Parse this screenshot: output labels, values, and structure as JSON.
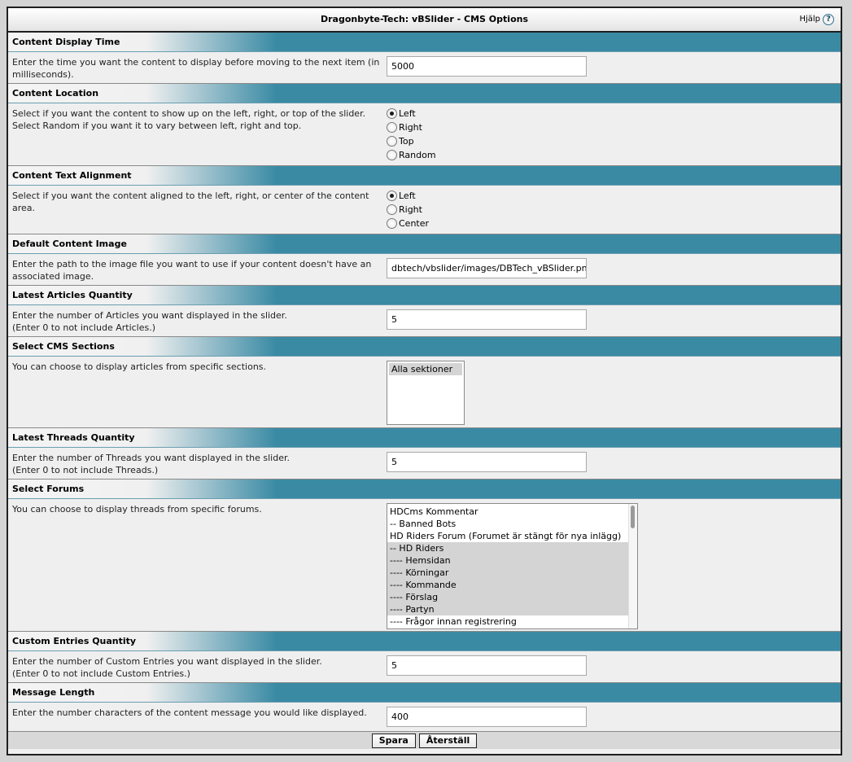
{
  "window": {
    "title": "Dragonbyte-Tech: vBSlider - CMS Options",
    "help_label": "Hjälp",
    "help_icon": "question-icon"
  },
  "sections": {
    "display_time": {
      "title": "Content Display Time",
      "desc": "Enter the time you want the content to display before moving to the next item (in milliseconds).",
      "value": "5000"
    },
    "location": {
      "title": "Content Location",
      "desc_1": "Select if you want the content to show up on the left, right, or top of the slider.",
      "desc_2": "Select Random if you want it to vary between left, right and top.",
      "options": [
        "Left",
        "Right",
        "Top",
        "Random"
      ],
      "selected": "Left"
    },
    "alignment": {
      "title": "Content Text Alignment",
      "desc": "Select if you want the content aligned to the left, right, or center of the content area.",
      "options": [
        "Left",
        "Right",
        "Center"
      ],
      "selected": "Left"
    },
    "default_image": {
      "title": "Default Content Image",
      "desc": "Enter the path to the image file you want to use if your content doesn't have an associated image.",
      "value": "dbtech/vbslider/images/DBTech_vBSlider.png"
    },
    "articles_qty": {
      "title": "Latest Articles Quantity",
      "desc_1": "Enter the number of Articles you want displayed in the slider.",
      "desc_2": "(Enter 0 to not include Articles.)",
      "value": "5"
    },
    "cms_sections": {
      "title": "Select CMS Sections",
      "desc": "You can choose to display articles from specific sections.",
      "items": [
        "Alla sektioner"
      ]
    },
    "threads_qty": {
      "title": "Latest Threads Quantity",
      "desc_1": "Enter the number of Threads you want displayed in the slider.",
      "desc_2": "(Enter 0 to not include Threads.)",
      "value": "5"
    },
    "forums": {
      "title": "Select Forums",
      "desc": "You can choose to display threads from specific forums.",
      "items": [
        "HDCms Kommentar",
        "-- Banned Bots",
        "HD Riders Forum (Forumet är stängt för nya inlägg)",
        "-- HD Riders",
        "---- Hemsidan",
        "---- Körningar",
        "---- Kommande",
        "---- Förslag",
        "---- Partyn",
        "---- Frågor innan registrering"
      ]
    },
    "custom_qty": {
      "title": "Custom Entries Quantity",
      "desc_1": "Enter the number of Custom Entries you want displayed in the slider.",
      "desc_2": "(Enter 0 to not include Custom Entries.)",
      "value": "5"
    },
    "message_length": {
      "title": "Message Length",
      "desc": "Enter the number characters of the content message you would like displayed.",
      "value": "400"
    }
  },
  "footer": {
    "save_label": "Spara",
    "reset_label": "Återställ"
  }
}
